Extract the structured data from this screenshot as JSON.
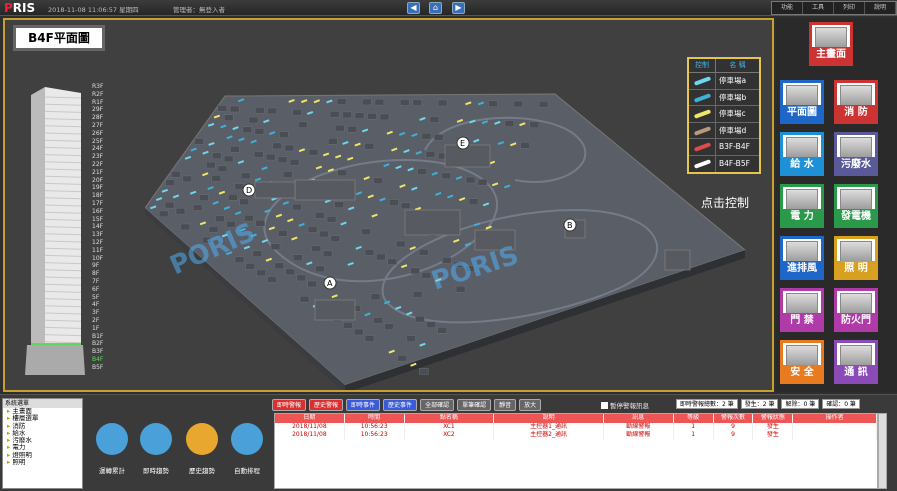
{
  "top": {
    "logo_a": "P",
    "logo_b": "RIS",
    "datetime": "2018-11-08 11:06:57 星期四",
    "admin": "管理者：無登入者",
    "nav": {
      "back": "◀",
      "home": "⌂",
      "forward": "▶"
    },
    "menu": [
      "功能",
      "工具",
      "列印",
      "說明"
    ]
  },
  "floorplan": {
    "title": "B4F平面圖",
    "floors": [
      "R3F",
      "R2F",
      "R1F",
      "29F",
      "28F",
      "27F",
      "26F",
      "25F",
      "24F",
      "23F",
      "22F",
      "21F",
      "20F",
      "19F",
      "18F",
      "17F",
      "16F",
      "15F",
      "14F",
      "13F",
      "12F",
      "11F",
      "10F",
      "9F",
      "8F",
      "7F",
      "6F",
      "5F",
      "4F",
      "3F",
      "2F",
      "1F",
      "B1F",
      "B2F",
      "B3F",
      "B4F",
      "B5F"
    ],
    "active_floor": "B4F",
    "markers": [
      "A",
      "B",
      "D",
      "E"
    ],
    "watermark": "PORIS",
    "legend": {
      "h1": "控制",
      "h2": "名 稱",
      "rows": [
        {
          "name": "停車場a",
          "color": "#6fd6f0"
        },
        {
          "name": "停車場b",
          "color": "#3fb0d8"
        },
        {
          "name": "停車場c",
          "color": "#eee56a"
        },
        {
          "name": "停車場d",
          "color": "#b89a7a"
        },
        {
          "name": "B3F-B4F",
          "color": "#e24a4a"
        },
        {
          "name": "B4F-B5F",
          "color": "#ffffff"
        }
      ]
    },
    "click_tip": "点击控制"
  },
  "side": {
    "buttons": [
      {
        "label": "主畫面",
        "color": "#cc3333"
      },
      {
        "label": "平面圖",
        "color": "#1e66c8"
      },
      {
        "label": "消 防",
        "color": "#cc3333"
      },
      {
        "label": "給 水",
        "color": "#1e90d8"
      },
      {
        "label": "污廢水",
        "color": "#5a5a9a"
      },
      {
        "label": "電 力",
        "color": "#2a9a4a"
      },
      {
        "label": "發電機",
        "color": "#2a9a4a"
      },
      {
        "label": "進排風",
        "color": "#1e66c8"
      },
      {
        "label": "照 明",
        "color": "#d8a020"
      },
      {
        "label": "門 禁",
        "color": "#b03aa8"
      },
      {
        "label": "防火門",
        "color": "#b03aa8"
      },
      {
        "label": "安 全",
        "color": "#e87a20"
      },
      {
        "label": "通 訊",
        "color": "#8a4ab8"
      }
    ]
  },
  "tree": {
    "header": "系統選單",
    "items": [
      "主畫面",
      "樓層選單",
      "消防",
      "給水",
      "污廢水",
      "電力",
      "燈照明",
      "照明"
    ]
  },
  "shortcuts": [
    {
      "label": "運轉累計",
      "color": "#4aa0d8"
    },
    {
      "label": "即時趨勢",
      "color": "#4aa0d8"
    },
    {
      "label": "歷史趨勢",
      "color": "#e8a830"
    },
    {
      "label": "自動排程",
      "color": "#4aa0d8"
    }
  ],
  "alarm": {
    "buttons": [
      {
        "label": "即時警報",
        "color": "#d83030"
      },
      {
        "label": "歷史警報",
        "color": "#d83030"
      },
      {
        "label": "即時事件",
        "color": "#3a5ad8"
      },
      {
        "label": "歷史事件",
        "color": "#3a5ad8"
      },
      {
        "label": "全部確認",
        "color": "#666"
      },
      {
        "label": "單筆確認",
        "color": "#666"
      },
      {
        "label": "靜音",
        "color": "#666"
      },
      {
        "label": "放大",
        "color": "#666"
      }
    ],
    "mute_label": "暫停警報訊息",
    "stats": [
      "即時警報總數：2 筆",
      "發生：2 筆",
      "解除：0 筆",
      "確認：0 筆"
    ],
    "columns": [
      "日期",
      "時間",
      "點名稱",
      "說明",
      "訊息",
      "等級",
      "警報次數",
      "警報狀態",
      "操作者"
    ],
    "rows": [
      [
        "2018/11/08",
        "10:56:23",
        "XC1",
        "主控器1_通訊",
        "斷線警報",
        "1",
        "9",
        "發生",
        ""
      ],
      [
        "2018/11/08",
        "10:56:23",
        "XC2",
        "主控器2_通訊",
        "斷線警報",
        "1",
        "9",
        "發生",
        ""
      ]
    ]
  }
}
